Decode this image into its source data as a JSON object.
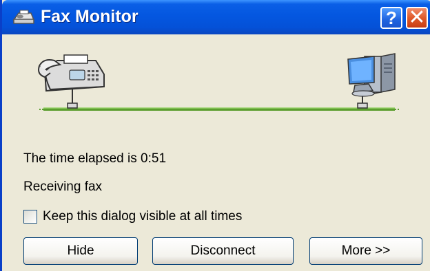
{
  "window": {
    "title": "Fax Monitor",
    "help_label": "?",
    "close_label": "✕"
  },
  "status": {
    "elapsed": "The time elapsed is 0:51",
    "state": "Receiving fax"
  },
  "options": {
    "keep_visible_label": "Keep this dialog visible at all times",
    "keep_visible_checked": false
  },
  "buttons": {
    "hide": "Hide",
    "disconnect": "Disconnect",
    "more": "More >>"
  },
  "icons": {
    "title": "fax-icon",
    "left_device": "fax-machine-icon",
    "right_device": "computer-icon",
    "connection": "network-line"
  },
  "colors": {
    "titlebar": "#0457e0",
    "line": "#7cc243",
    "background": "#ece9d8"
  }
}
